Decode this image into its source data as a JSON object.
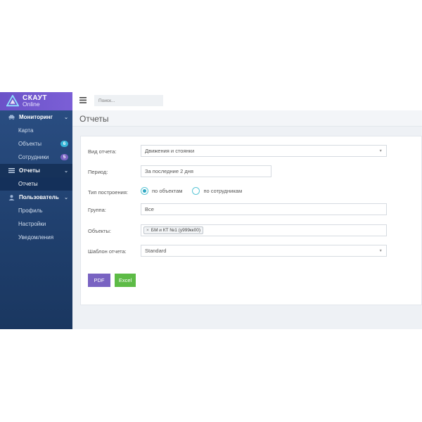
{
  "logo": {
    "title": "СКАУТ",
    "subtitle": "Online"
  },
  "sidebar": {
    "sections": [
      {
        "label": "Мониторинг",
        "icon": "car-icon"
      },
      {
        "label": "Отчеты",
        "icon": "list-icon"
      },
      {
        "label": "Пользователь",
        "icon": "user-icon"
      }
    ],
    "items": {
      "map": "Карта",
      "objects": "Объекты",
      "objects_badge": "6",
      "employees": "Сотрудники",
      "employees_badge": "5",
      "reports": "Отчеты",
      "profile": "Профиль",
      "settings": "Настройки",
      "notifications": "Уведомления"
    }
  },
  "topbar": {
    "search_placeholder": "Поиск..."
  },
  "page": {
    "title": "Отчеты"
  },
  "form": {
    "report_type_label": "Вид отчета:",
    "report_type_value": "Движения и стоянки",
    "period_label": "Период:",
    "period_value": "За последние 2 дня",
    "build_type_label": "Тип построения:",
    "build_by_objects": "по объектам",
    "build_by_employees": "по сотрудникам",
    "group_label": "Группа:",
    "group_value": "Все",
    "objects_label": "Объекты:",
    "objects_tag": "БМ и КТ №1 (у999кк00)",
    "template_label": "Шаблон отчета:",
    "template_value": "Standard",
    "pdf_button": "PDF",
    "excel_button": "Excel"
  },
  "colors": {
    "accent": "#7963c2",
    "success": "#5dbb46",
    "badge_objects": "#36b5d8",
    "badge_employees": "#7963c2",
    "radio": "#2fa7c2"
  }
}
